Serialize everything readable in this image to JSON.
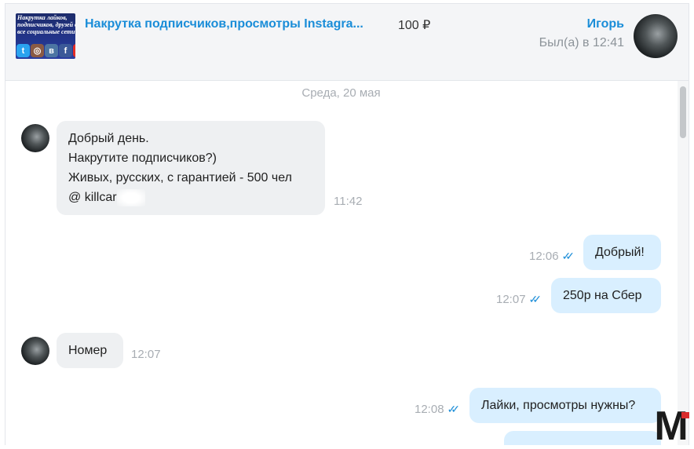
{
  "listing": {
    "thumb_text_lines": [
      "Накрутка лайков,",
      "подписчиков, друзей в",
      "все социальные сети"
    ],
    "thumb_icons": [
      "twitter-icon",
      "instagram-icon",
      "vk-icon",
      "facebook-icon",
      "youtube-icon"
    ],
    "title": "Накрутка подписчиков,просмотры Instagra...",
    "price": "100 ₽"
  },
  "user": {
    "name": "Игорь",
    "status": "Был(а) в 12:41"
  },
  "chat": {
    "date_divider": "Среда, 20 мая",
    "messages": [
      {
        "direction": "in",
        "lines": [
          "Добрый день.",
          "Накрутите подписчиков?)",
          "Живых, русских, с гарантией - 500 чел",
          "@ killcar"
        ],
        "time": "11:42"
      },
      {
        "direction": "out",
        "text": "Добрый!",
        "time": "12:06",
        "read": true
      },
      {
        "direction": "out",
        "text": "250р на Сбер",
        "time": "12:07",
        "read": true
      },
      {
        "direction": "in",
        "text": "Номер",
        "time": "12:07"
      },
      {
        "direction": "out",
        "text": "Лайки, просмотры нужны?",
        "time": "12:08",
        "read": true
      }
    ]
  },
  "colors": {
    "accent": "#1a8dd8",
    "incoming_bubble": "#eef0f2",
    "outgoing_bubble": "#d9efff",
    "muted_text": "#a8adb3",
    "header_bg": "#f4f5f7"
  },
  "watermark": {
    "letter": "M"
  }
}
